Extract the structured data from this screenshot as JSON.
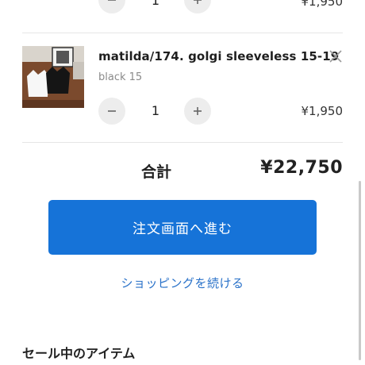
{
  "previous_item": {
    "quantity": "1",
    "price": "¥1,950"
  },
  "cart_item": {
    "title": "matilda/174. golgi sleeveless 15-19",
    "variant": "black 15",
    "quantity": "1",
    "price": "¥1,950",
    "thumbnail_alt": "product photo"
  },
  "summary": {
    "total_label": "合計",
    "total_value": "¥22,750"
  },
  "actions": {
    "checkout_label": "注文画面へ進む",
    "continue_label": "ショッピングを続ける"
  },
  "sale_section": {
    "title": "セール中のアイテム"
  },
  "colors": {
    "primary": "#1673d8",
    "link": "#2a72c9"
  }
}
